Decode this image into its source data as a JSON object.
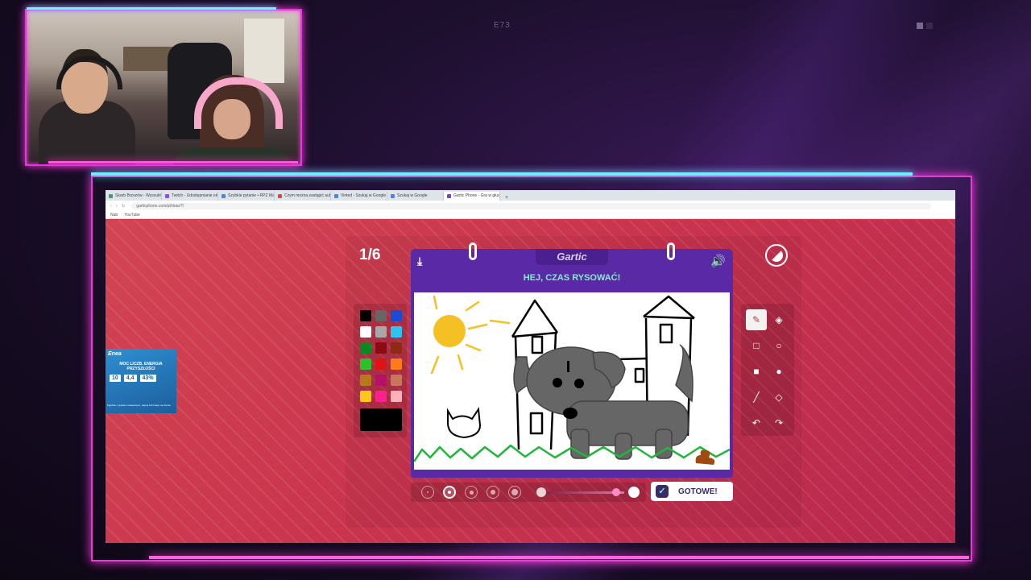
{
  "overlay": {
    "episode_code": "E73"
  },
  "browser": {
    "tabs": [
      {
        "label": "Skarb Brzozów - Wyszukiwarka",
        "color": "#34a853"
      },
      {
        "label": "Twitch - Udostępnianie ekranu",
        "color": "#9146ff"
      },
      {
        "label": "Szybkie pytanie • RPZ Maps",
        "color": "#4285f4"
      },
      {
        "label": "Czym można zastąpić auto",
        "color": "#ea4335"
      },
      {
        "label": "Vinted - Szukaj w Google",
        "color": "#4285f4"
      },
      {
        "label": "Szukaj w Google",
        "color": "#4285f4"
      },
      {
        "label": "Gartic Phone - Gra w głuchy tel",
        "color": "#7b3fd1"
      }
    ],
    "new_tab": "+",
    "url": "garticphone.com/pl/draw?l",
    "bookmarks": [
      "Nab",
      "YouTube"
    ]
  },
  "ad": {
    "brand": "Enea",
    "headline": "MOC LICZB. ENERGIA PRZYSZŁOŚCI",
    "stats": [
      "10",
      "4,4",
      "43%"
    ],
    "footnote": "Zgodnie z prawem ustawowym, więcej informacji na stronie"
  },
  "game": {
    "round": "1/6",
    "logo": "Gartic",
    "instruction": "HEJ, CZAS RYSOWAĆ!",
    "done_label": "GOTOWE!",
    "palette": [
      "#000000",
      "#666666",
      "#1c4bd8",
      "#ffffff",
      "#a8a8a8",
      "#2ec4f0",
      "#0a8a1e",
      "#8c0a12",
      "#8f2a14",
      "#2cc02c",
      "#e01212",
      "#ff7a1a",
      "#b57a1c",
      "#b80f6a",
      "#c9765e",
      "#ffc61a",
      "#ff1f8e",
      "#ffb0b8"
    ],
    "current_color": "#000000",
    "brush_slider_fraction": 0.9,
    "selected_size_index": 1
  }
}
